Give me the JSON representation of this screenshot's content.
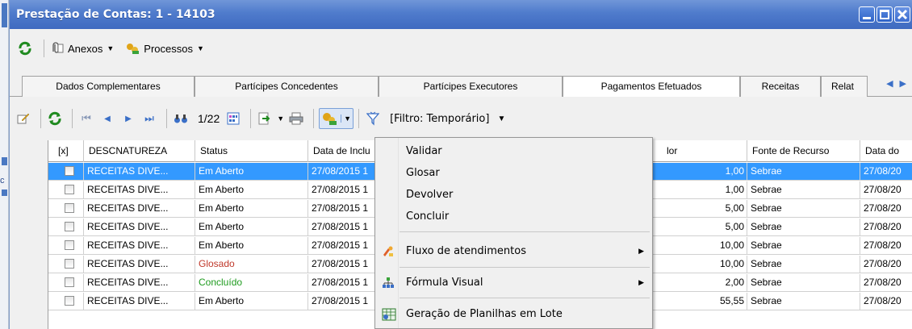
{
  "window": {
    "title": "Prestação de Contas: 1 - 14103"
  },
  "left_strip": {
    "letter": "c"
  },
  "menubar": {
    "anexos": "Anexos",
    "processos": "Processos"
  },
  "tabs": [
    {
      "label": "Dados Complementares"
    },
    {
      "label": "Partícipes Concedentes"
    },
    {
      "label": "Partícipes Executores"
    },
    {
      "label": "Pagamentos Efetuados"
    },
    {
      "label": "Receitas"
    },
    {
      "label": "Relat"
    }
  ],
  "toolbar": {
    "page_indicator": "1/22",
    "filter": "[Filtro: Temporário]"
  },
  "grid": {
    "columns": {
      "check": "[x]",
      "descnatureza": "DESCNATUREZA",
      "status": "Status",
      "data_inclusao": "Data de Inclu",
      "valor": "lor",
      "fonte": "Fonte de Recurso",
      "data_do": "Data do"
    },
    "rows": [
      {
        "desc": "RECEITAS DIVE...",
        "status": "Em Aberto",
        "data": "27/08/2015 1",
        "valor": "1,00",
        "fonte": "Sebrae",
        "data_do": "27/08/20",
        "kind": "aberto"
      },
      {
        "desc": "RECEITAS DIVE...",
        "status": "Em Aberto",
        "data": "27/08/2015 1",
        "valor": "1,00",
        "fonte": "Sebrae",
        "data_do": "27/08/20",
        "kind": "aberto"
      },
      {
        "desc": "RECEITAS DIVE...",
        "status": "Em Aberto",
        "data": "27/08/2015 1",
        "valor": "5,00",
        "fonte": "Sebrae",
        "data_do": "27/08/20",
        "kind": "aberto"
      },
      {
        "desc": "RECEITAS DIVE...",
        "status": "Em Aberto",
        "data": "27/08/2015 1",
        "valor": "5,00",
        "fonte": "Sebrae",
        "data_do": "27/08/20",
        "kind": "aberto"
      },
      {
        "desc": "RECEITAS DIVE...",
        "status": "Em Aberto",
        "data": "27/08/2015 1",
        "valor": "10,00",
        "fonte": "Sebrae",
        "data_do": "27/08/20",
        "kind": "aberto"
      },
      {
        "desc": "RECEITAS DIVE...",
        "status": "Glosado",
        "data": "27/08/2015 1",
        "valor": "10,00",
        "fonte": "Sebrae",
        "data_do": "27/08/20",
        "kind": "glosado"
      },
      {
        "desc": "RECEITAS DIVE...",
        "status": "Concluído",
        "data": "27/08/2015 1",
        "valor": "2,00",
        "fonte": "Sebrae",
        "data_do": "27/08/20",
        "kind": "concluido"
      },
      {
        "desc": "RECEITAS DIVE...",
        "status": "Em Aberto",
        "data": "27/08/2015 1",
        "valor": "55,55",
        "fonte": "Sebrae",
        "data_do": "27/08/20",
        "kind": "aberto"
      }
    ]
  },
  "context_menu": {
    "validar": "Validar",
    "glosar": "Glosar",
    "devolver": "Devolver",
    "concluir": "Concluir",
    "fluxo": "Fluxo de atendimentos",
    "formula": "Fórmula Visual",
    "geracao": "Geração de Planilhas em Lote"
  },
  "colors": {
    "selection": "#3399ff",
    "titlebar": "#4f7bcc",
    "glosado": "#c0392b",
    "concluido": "#1e9b1e"
  }
}
